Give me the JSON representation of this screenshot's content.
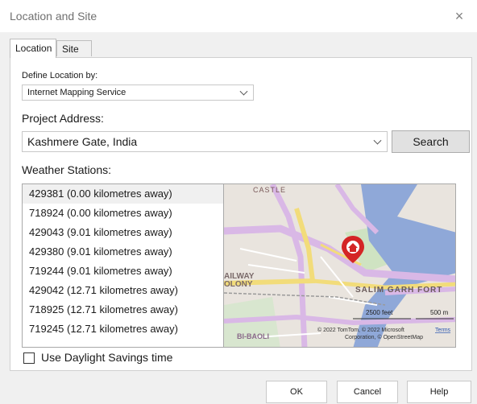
{
  "window": {
    "title": "Location and Site",
    "close_glyph": "×"
  },
  "tabs": [
    {
      "label": "Location",
      "active": true
    },
    {
      "label": "Site",
      "active": false
    }
  ],
  "define_location": {
    "label": "Define Location by:",
    "selected": "Internet Mapping Service"
  },
  "project_address": {
    "label": "Project Address:",
    "value": "Kashmere Gate, India",
    "search_label": "Search"
  },
  "weather": {
    "label": "Weather Stations:",
    "stations": [
      "429381 (0.00 kilometres away)",
      "718924 (0.00 kilometres away)",
      "429043 (9.01 kilometres away)",
      "429380 (9.01 kilometres away)",
      "719244 (9.01 kilometres away)",
      "429042 (12.71 kilometres away)",
      "718925 (12.71 kilometres away)",
      "719245 (12.71 kilometres away)"
    ],
    "selected_index": 0
  },
  "map": {
    "labels": {
      "castle": "CASTLE",
      "railway_1": "AILWAY",
      "railway_2": "OLONY",
      "fort": "SALIM GARH FORT",
      "baoli": "BI-BAOLI",
      "scale_feet": "2500 feet",
      "scale_m": "500 m",
      "copyright_1": "© 2022 TomTom, © 2022 Microsoft",
      "terms": "Terms",
      "copyright_2": "Corporation, © OpenStreetMap"
    },
    "pin_icon": "home-map-pin-icon",
    "colors": {
      "river": "#8fa8d8",
      "road_major": "#e3c6ec",
      "road_yellow": "#f2dc7a",
      "land": "#e9e4de",
      "park": "#cfe3c2",
      "pin": "#d42525"
    }
  },
  "daylight": {
    "label": "Use Daylight Savings time",
    "checked": false
  },
  "footer": {
    "ok": "OK",
    "cancel": "Cancel",
    "help": "Help"
  }
}
